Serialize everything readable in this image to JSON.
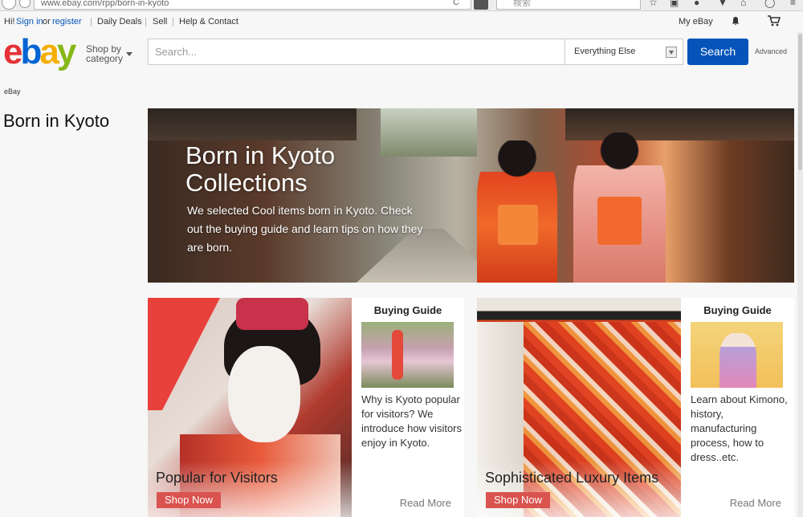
{
  "browser": {
    "url": "www.ebay.com/rpp/born-in-kyoto",
    "search_placeholder": "検索"
  },
  "topbar": {
    "greeting": "Hi!",
    "sign_in": "Sign in",
    "or": "or",
    "register": "register",
    "daily_deals": "Daily Deals",
    "sell": "Sell",
    "help": "Help & Contact",
    "my_ebay": "My eBay"
  },
  "header": {
    "logo": {
      "e": "e",
      "b": "b",
      "a": "a",
      "y": "y"
    },
    "shop_by": "Shop by category",
    "search_placeholder": "Search...",
    "category": "Everything Else",
    "search_button": "Search",
    "advanced": "Advanced"
  },
  "breadcrumb": "eBay",
  "page_title": "Born in Kyoto",
  "hero": {
    "title": "Born in Kyoto Collections",
    "description": "We selected Cool items born in Kyoto. Check out the buying guide and learn tips on how they are born."
  },
  "cards": [
    {
      "title": "Popular for Visitors",
      "shop_now": "Shop Now",
      "guide_heading": "Buying Guide",
      "guide_text": "Why is Kyoto popular for visitors? We introduce how visitors enjoy in Kyoto.",
      "read_more": "Read More"
    },
    {
      "title": "Sophisticated Luxury Items",
      "shop_now": "Shop Now",
      "guide_heading": "Buying Guide",
      "guide_text": "Learn about Kimono, history, manufacturing process, how to dress..etc.",
      "read_more": "Read More"
    }
  ],
  "colors": {
    "link": "#0654ba",
    "search_button": "#0654ba",
    "shop_now": "#d9534f"
  }
}
